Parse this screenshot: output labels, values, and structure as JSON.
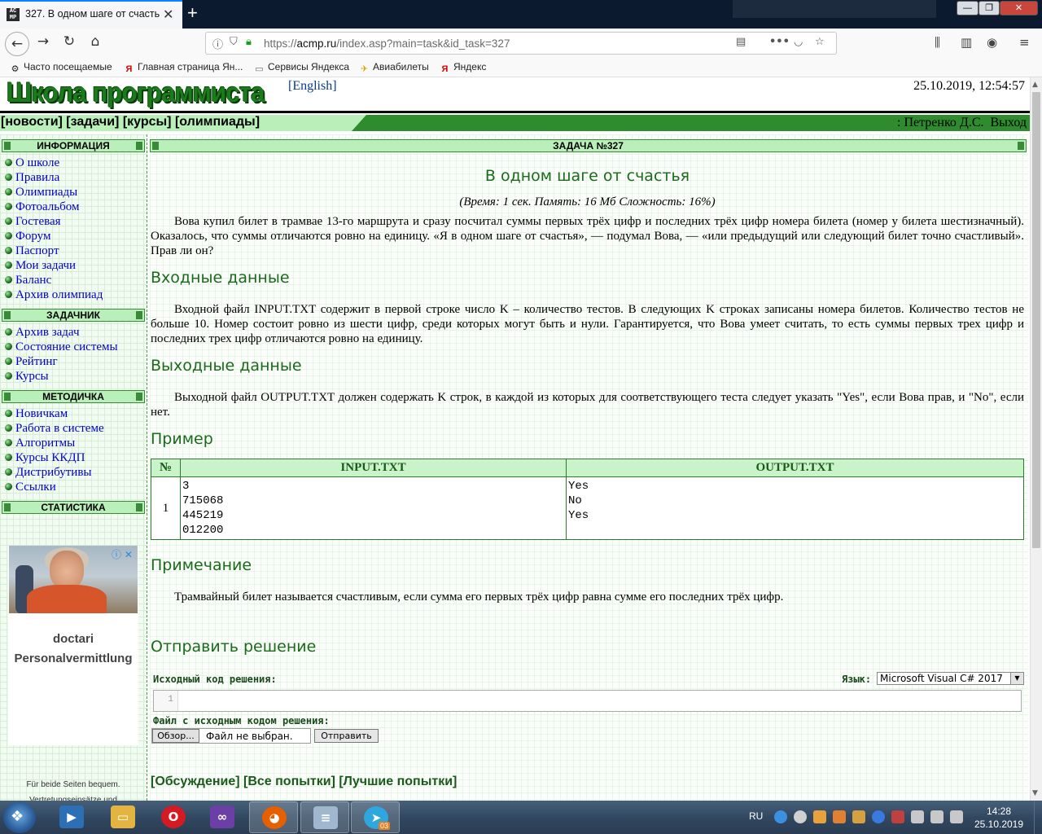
{
  "browser": {
    "tab_title": "327. В одном шаге от счастья",
    "tab_favicon_text": "AC MP",
    "new_tab_label": "+",
    "url_prefix": "https://",
    "url_host": "acmp.ru",
    "url_path": "/index.asp?main=task&id_task=327",
    "bookmarks": [
      {
        "label": "Часто посещаемые",
        "icon": "gear-icon"
      },
      {
        "label": "Главная страница Ян...",
        "icon": "yandex-icon"
      },
      {
        "label": "Сервисы Яндекса",
        "icon": "folder-icon"
      },
      {
        "label": "Авиабилеты",
        "icon": "plane-icon"
      },
      {
        "label": "Яндекс",
        "icon": "yandex-icon"
      }
    ]
  },
  "site": {
    "logo": "Школа программиста",
    "lang_link": "[English]",
    "datetime": "25.10.2019, 12:54:57",
    "menu": "[новости] [задачи] [курсы] [олимпиады]",
    "user": ": Петренко Д.С.",
    "logout": "Выход"
  },
  "sidebar": {
    "sections": [
      {
        "title": "ИНФОРМАЦИЯ",
        "items": [
          "О школе",
          "Правила",
          "Олимпиады",
          "Фотоальбом",
          "Гостевая",
          "Форум",
          "Паспорт",
          "Мои задачи",
          "Баланс",
          "Архив олимпиад"
        ]
      },
      {
        "title": "ЗАДАЧНИК",
        "items": [
          "Архив задач",
          "Состояние системы",
          "Рейтинг",
          "Курсы"
        ]
      },
      {
        "title": "МЕТОДИЧКА",
        "items": [
          "Новичкам",
          "Работа в системе",
          "Алгоритмы",
          "Курсы ККДП",
          "Дистрибутивы",
          "Ссылки"
        ]
      },
      {
        "title": "СТАТИСТИКА",
        "items": []
      }
    ],
    "ad": {
      "icons": "ⓘ ✕",
      "title": "doctari Personalvermittlung",
      "small_line1": "Für beide Seiten bequem.",
      "small_line2": "Vertretungseinsätze und"
    }
  },
  "task": {
    "header": "ЗАДАЧА №327",
    "title": "В одном шаге от счастья",
    "limits": "(Время: 1 сек. Память: 16 Мб Сложность: 16%)",
    "statement": "Вова купил билет в трамвае 13-го маршрута и сразу посчитал суммы первых трёх цифр и последних трёх цифр номера билета (номер у билета шестизначный). Оказалось, что суммы отличаются ровно на единицу. «Я в одном шаге от счастья», — подумал Вова, — «или предыдущий или следующий билет точно счастливый». Прав ли он?",
    "input_heading": "Входные данные",
    "input_text": "Входной файл INPUT.TXT содержит в первой строке число K – количество тестов. В следующих K строках записаны номера билетов. Количество тестов не больше 10. Номер состоит ровно из шести цифр, среди которых могут быть и нули. Гарантируется, что Вова умеет считать, то есть суммы первых трех цифр и последних трех цифр отличаются ровно на единицу.",
    "output_heading": "Выходные данные",
    "output_text": "Выходной файл OUTPUT.TXT должен содержать K строк, в каждой из которых для соответствующего теста следует указать \"Yes\", если Вова прав, и \"No\", если нет.",
    "example_heading": "Пример",
    "example": {
      "col_num": "№",
      "col_input": "INPUT.TXT",
      "col_output": "OUTPUT.TXT",
      "rows": [
        {
          "num": "1",
          "input": "3\n715068\n445219\n012200",
          "output": "Yes\nNo\nYes"
        }
      ]
    },
    "note_heading": "Примечание",
    "note_text": "Трамвайный билет называется счастливым, если сумма его первых трёх цифр равна сумме его последних трёх цифр.",
    "submit_heading": "Отправить решение",
    "source_label": "Исходный код решения:",
    "lang_label": "Язык:",
    "lang_value": "Microsoft Visual C# 2017",
    "line_number": "1",
    "file_label": "Файл с исходным кодом решения:",
    "browse_button": "Обзор...",
    "no_file": "Файл не выбран.",
    "submit_button": "Отправить",
    "bottom_links": "[Обсуждение] [Все попытки] [Лучшие попытки]"
  },
  "taskbar": {
    "lang": "RU",
    "time": "14:28",
    "date": "25.10.2019",
    "telegram_badge": "03"
  }
}
